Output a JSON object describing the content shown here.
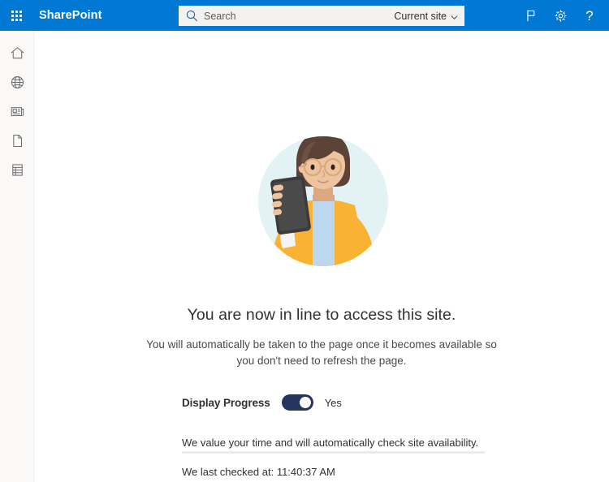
{
  "suite": {
    "waffle_icon": "app-launcher-waffle-icon",
    "brand": "SharePoint",
    "search": {
      "icon": "search-icon",
      "placeholder": "Search",
      "value": "",
      "scope_label": "Current site",
      "scope_chevron_icon": "chevron-down-icon"
    },
    "actions": [
      {
        "name": "feedback-button",
        "icon": "flag-icon",
        "label": "Feedback"
      },
      {
        "name": "settings-button",
        "icon": "gear-icon",
        "label": "Settings"
      },
      {
        "name": "help-button",
        "icon": "question-mark-icon",
        "label": "Help",
        "glyph": "?"
      }
    ]
  },
  "rail": {
    "items": [
      {
        "name": "rail-item-home",
        "icon": "home-icon",
        "label": "Home"
      },
      {
        "name": "rail-item-sites",
        "icon": "globe-icon",
        "label": "Sites"
      },
      {
        "name": "rail-item-news",
        "icon": "news-icon",
        "label": "News"
      },
      {
        "name": "rail-item-files",
        "icon": "page-icon",
        "label": "Files"
      },
      {
        "name": "rail-item-lists",
        "icon": "list-table-icon",
        "label": "Lists"
      }
    ]
  },
  "main": {
    "illustration": {
      "name": "person-holding-phone-illustration",
      "description": "Woman with hair bun and glasses holding a smartphone inside a light blue circle",
      "colors": {
        "circle": "#e3f2f5",
        "hair": "#5b4437",
        "hair_stick": "#f4ae3f",
        "skin": "#eec4a0",
        "skin_shadow": "#dca87f",
        "jacket": "#f9b233",
        "shirt": "#bdd7ee",
        "phone": "#3b3b3b",
        "cuff": "#f4f4f4"
      }
    },
    "headline": "You are now in line to access this site.",
    "subline": "You will automatically be taken to the page once it becomes available so you don't need to refresh the page.",
    "toggle": {
      "label": "Display Progress",
      "state_text": "Yes",
      "checked": true,
      "on_color": "#25355e"
    },
    "note": "We value your time and will automatically check site availability.",
    "progress": {
      "indeterminate": true,
      "track_color": "#edebe9",
      "bar_color": "#2f3f63"
    },
    "timestamp": "We last checked at: 11:40:37 AM"
  },
  "theme": {
    "suite_bar": "#0078d4",
    "rail_background": "#faf9f8",
    "content_background": "#ffffff",
    "text_primary": "#323130"
  }
}
